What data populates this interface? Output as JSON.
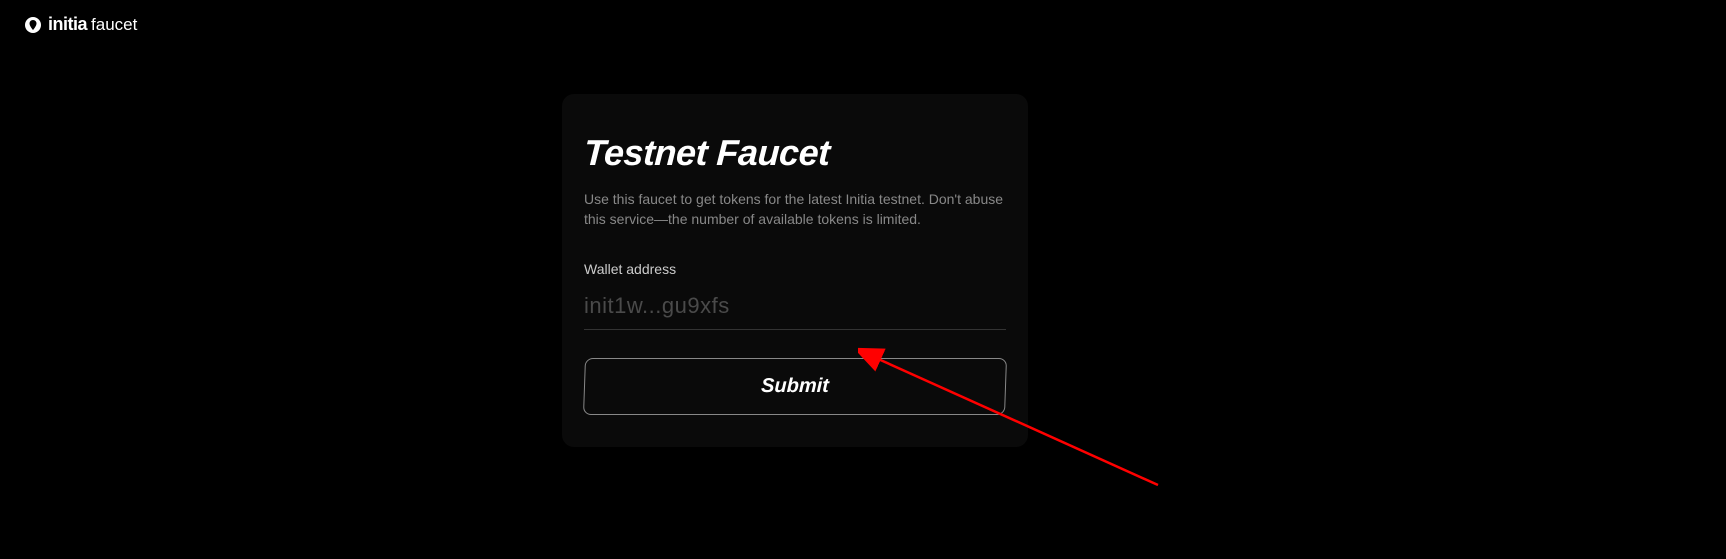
{
  "header": {
    "brand": "initia",
    "product": "faucet"
  },
  "card": {
    "title": "Testnet Faucet",
    "description": "Use this faucet to get tokens for the latest Initia testnet. Don't abuse this service—the number of available tokens is limited.",
    "field_label": "Wallet address",
    "input_placeholder": "init1w...gu9xfs",
    "input_value": "",
    "submit_label": "Submit"
  }
}
